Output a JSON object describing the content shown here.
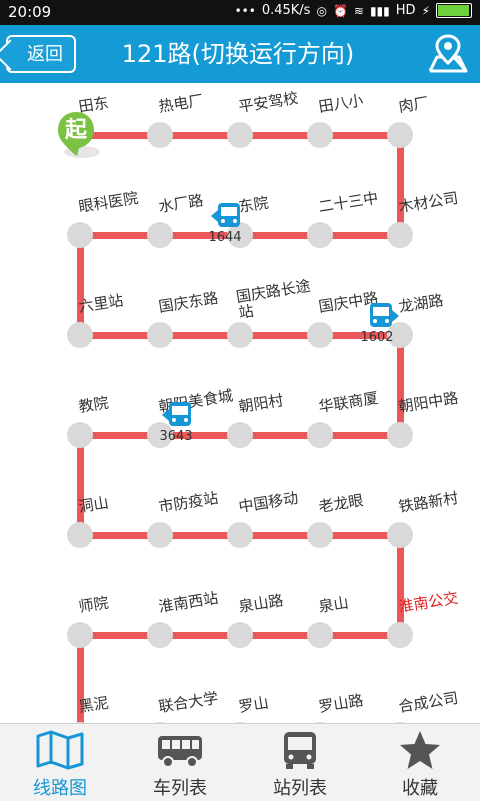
{
  "status": {
    "time": "20:09",
    "speed": "0.45K/s",
    "network": "HD"
  },
  "header": {
    "back_label": "返回",
    "title": "121路(切换运行方向)"
  },
  "start_badge": "起",
  "stations": [
    "田东",
    "热电厂",
    "平安驾校",
    "田八小",
    "肉厂",
    "木材公司",
    "二十三中",
    "东院",
    "水厂路",
    "眼科医院",
    "六里站",
    "国庆东路",
    "国庆路长途站",
    "国庆中路",
    "龙湖路",
    "朝阳中路",
    "华联商厦",
    "朝阳村",
    "朝阳美食城",
    "教院",
    "洞山",
    "市防疫站",
    "中国移动",
    "老龙眼",
    "铁路新村",
    "淮南公交",
    "泉山",
    "泉山路",
    "淮南西站",
    "师院",
    "黑泥",
    "联合大学",
    "罗山",
    "罗山路",
    "合成公司"
  ],
  "buses": [
    {
      "number": "1644"
    },
    {
      "number": "1602"
    },
    {
      "number": "3643"
    }
  ],
  "tabs": [
    {
      "label": "线路图",
      "icon": "map-icon"
    },
    {
      "label": "车列表",
      "icon": "bus-side-icon"
    },
    {
      "label": "站列表",
      "icon": "bus-front-icon"
    },
    {
      "label": "收藏",
      "icon": "star-icon"
    }
  ],
  "colors": {
    "header": "#149bd6",
    "route": "#ec5759",
    "stop": "#d9d9d9",
    "accent": "#1696d6",
    "badge": "#7cc242"
  }
}
